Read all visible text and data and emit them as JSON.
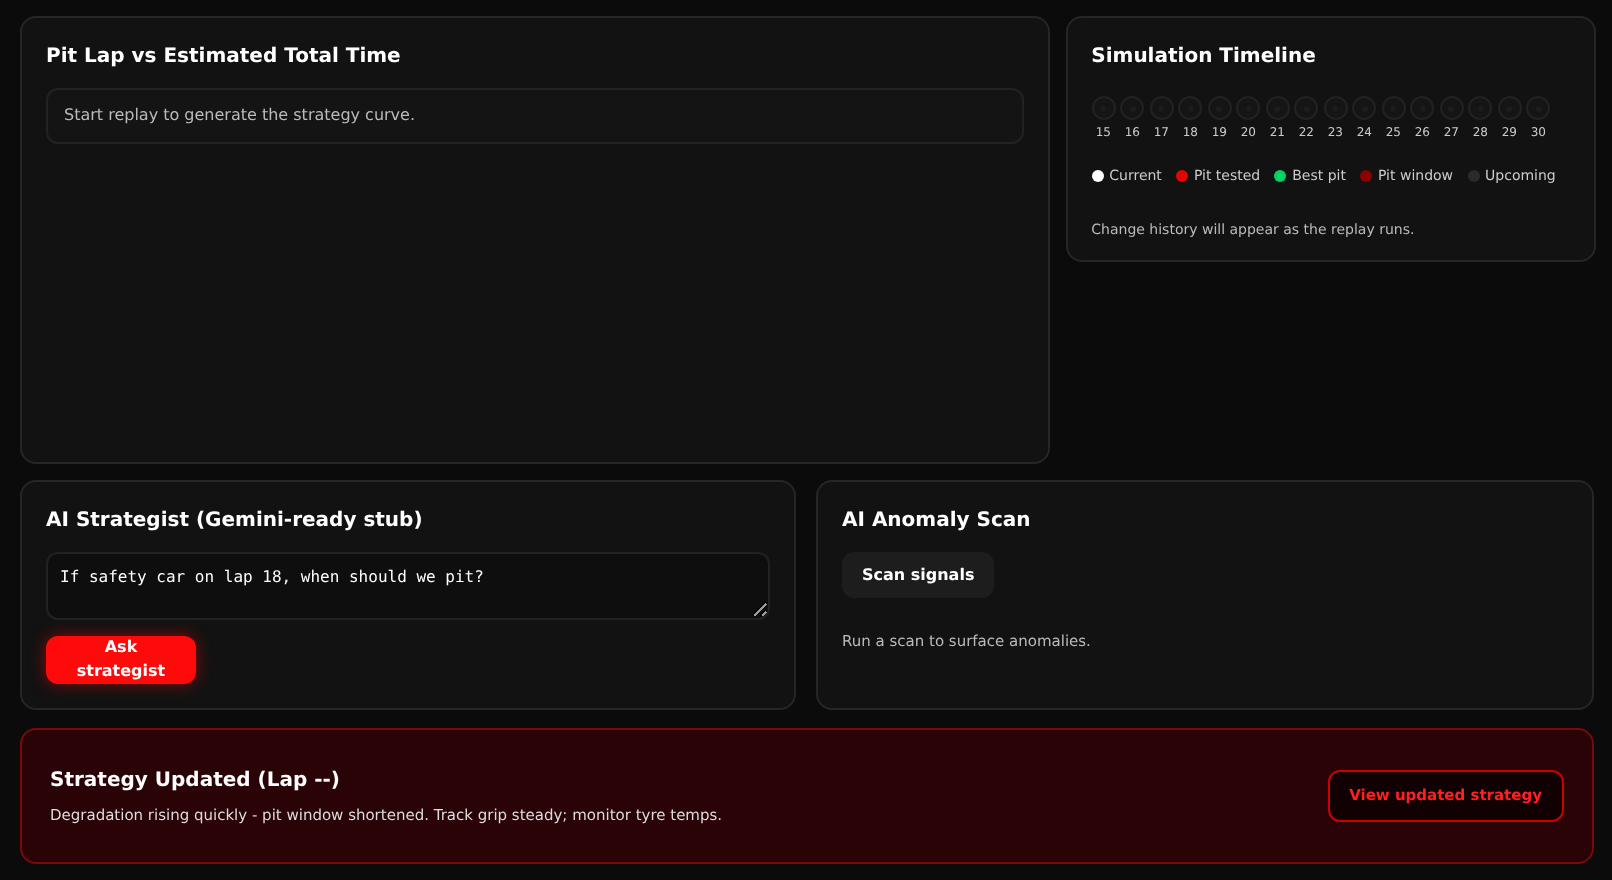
{
  "chart_panel": {
    "title": "Pit Lap vs Estimated Total Time",
    "message": "Start replay to generate the strategy curve."
  },
  "timeline": {
    "title": "Simulation Timeline",
    "laps": [
      {
        "label": "15",
        "kind": "upcoming"
      },
      {
        "label": "16",
        "kind": "upcoming"
      },
      {
        "label": "17",
        "kind": "upcoming"
      },
      {
        "label": "18",
        "kind": "upcoming"
      },
      {
        "label": "19",
        "kind": "upcoming"
      },
      {
        "label": "20",
        "kind": "upcoming"
      },
      {
        "label": "21",
        "kind": "upcoming"
      },
      {
        "label": "22",
        "kind": "upcoming"
      },
      {
        "label": "23",
        "kind": "upcoming"
      },
      {
        "label": "24",
        "kind": "upcoming"
      },
      {
        "label": "25",
        "kind": "upcoming"
      },
      {
        "label": "26",
        "kind": "upcoming"
      },
      {
        "label": "27",
        "kind": "upcoming"
      },
      {
        "label": "28",
        "kind": "upcoming"
      },
      {
        "label": "29",
        "kind": "upcoming"
      },
      {
        "label": "30",
        "kind": "upcoming"
      }
    ],
    "legend": [
      {
        "label": "Current",
        "color": "#ffffff"
      },
      {
        "label": "Pit tested",
        "color": "#e10600"
      },
      {
        "label": "Best pit",
        "color": "#00d26a"
      },
      {
        "label": "Pit window",
        "color": "#8b0000"
      },
      {
        "label": "Upcoming",
        "color": "#2a2a2a"
      }
    ],
    "history": "Change history will appear as the replay runs."
  },
  "strategist": {
    "title": "AI Strategist (Gemini-ready stub)",
    "question": "If safety car on lap 18, when should we pit?",
    "button": "Ask strategist"
  },
  "anomaly": {
    "title": "AI Anomaly Scan",
    "button": "Scan signals",
    "message": "Run a scan to surface anomalies."
  },
  "banner": {
    "title": "Strategy Updated (Lap --)",
    "message": "Degradation rising quickly - pit window shortened. Track grip steady; monitor tyre temps.",
    "button": "View updated strategy"
  }
}
